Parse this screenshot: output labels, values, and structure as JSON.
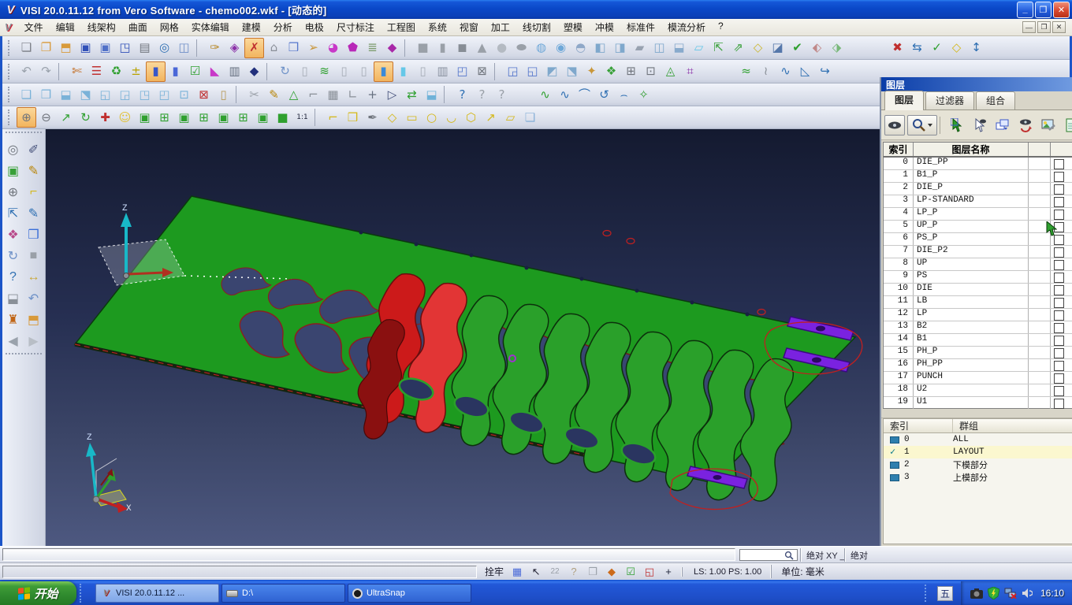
{
  "titlebar": {
    "title": "VISI 20.0.11.12 from Vero Software - chemo002.wkf - [动态的]",
    "app_mark": "V"
  },
  "menubar": {
    "items": [
      "文件",
      "编辑",
      "线架构",
      "曲面",
      "网格",
      "实体编辑",
      "建模",
      "分析",
      "电极",
      "尺寸标注",
      "工程图",
      "系统",
      "视窗",
      "加工",
      "线切割",
      "塑模",
      "冲模",
      "标准件",
      "模流分析",
      "?"
    ]
  },
  "toolbars": {
    "r1": [
      [
        "❏",
        "#7a7d85",
        "new-file"
      ],
      [
        "❐",
        "#d89a3a",
        "open-file"
      ],
      [
        "⬒",
        "#d89a3a",
        "folder-documents"
      ],
      [
        "▣",
        "#3050b8",
        "save"
      ],
      [
        "▣",
        "#5070c8",
        "save-as"
      ],
      [
        "◳",
        "#3050b8",
        "save-part"
      ],
      [
        "▤",
        "#70757d",
        "print"
      ],
      [
        "◎",
        "#2e6fb2",
        "print-preview"
      ],
      [
        "◫",
        "#7090c8",
        "split-window"
      ],
      "|",
      [
        "✑",
        "#b88a2a",
        "sketch-tool"
      ],
      [
        "◈",
        "#8a30a8",
        "point-tool"
      ],
      [
        "✗",
        "#c03030",
        "delete-sketch",
        "sel"
      ],
      [
        "⌂",
        "#8a8f98",
        "analysis-marker"
      ],
      [
        "❒",
        "#5577cc",
        "sheet-cube"
      ],
      [
        "➢",
        "#c9973a",
        "direction-arrow"
      ],
      [
        "◕",
        "#c838c8",
        "rainbow-surface"
      ],
      [
        "⬟",
        "#b828b8",
        "solid-magenta"
      ],
      [
        "≣",
        "#7a9a6a",
        "layer-stack"
      ],
      [
        "◆",
        "#a828a8",
        "magenta-box"
      ],
      "|",
      [
        "■",
        "#9aa0a8",
        "box-primitive"
      ],
      [
        "▮",
        "#9aa0a8",
        "cylinder-primitive"
      ],
      [
        "◼",
        "#878d95",
        "block-primitive"
      ],
      [
        "▲",
        "#9aa0a8",
        "cone-primitive"
      ],
      [
        "●",
        "#b4bac2",
        "sphere-primitive"
      ],
      [
        "⬬",
        "#9aa0a8",
        "torus-primitive"
      ],
      [
        "◍",
        "#6fa8d8",
        "extrude-tool"
      ],
      [
        "◉",
        "#6fa8d8",
        "revolve-tool"
      ],
      [
        "◓",
        "#8fa8c8",
        "half-sphere"
      ],
      [
        "◧",
        "#7fa8cc",
        "boolean-union"
      ],
      [
        "◨",
        "#7fa8cc",
        "boolean-subtract"
      ],
      [
        "▰",
        "#98a2b0",
        "boolean-intersect"
      ],
      [
        "◫",
        "#7fa8cc",
        "shell-tool"
      ],
      [
        "⬓",
        "#88aacc",
        "split-solid"
      ],
      [
        "▱",
        "#66c8e8",
        "plane-tool"
      ],
      [
        "⇱",
        "#38a038",
        "move-face"
      ],
      [
        "⇗",
        "#38a038",
        "pull-face"
      ],
      [
        "◇",
        "#ccb833",
        "feature-tool"
      ],
      [
        "◪",
        "#5577aa",
        "fillet-tool"
      ],
      [
        "✔",
        "#2fa02f",
        "validate-tool"
      ],
      [
        "⬖",
        "#c08888",
        "deform-tool"
      ],
      [
        "⬗",
        "#78b878",
        "blend-tool"
      ],
      "g52",
      [
        "✖",
        "#c03030",
        "right-tool-reset"
      ],
      [
        "⇆",
        "#2e6fb2",
        "right-tool-swap"
      ],
      [
        "✓",
        "#2fa02f",
        "right-tool-confirm"
      ],
      [
        "◇",
        "#d4b81a",
        "right-tool-frame"
      ],
      [
        "↕",
        "#2e6fb2",
        "right-tool-flip"
      ]
    ],
    "r2": [
      [
        "↶",
        "#9aa2ac",
        "undo"
      ],
      [
        "↷",
        "#9aa2ac",
        "redo"
      ],
      "|",
      [
        "✄",
        "#c06515",
        "trim-curves"
      ],
      [
        "☰",
        "#c03030",
        "attribute-filter"
      ],
      [
        "♻",
        "#2fa02f",
        "recycle-filter"
      ],
      [
        "±",
        "#b8a200",
        "plus-minus-tool"
      ],
      [
        "▮",
        "#3a57c8",
        "cylinder-select",
        "sel"
      ],
      [
        "▮",
        "#4a67d8",
        "cylinder-view"
      ],
      [
        "☑",
        "#2fa02f",
        "validate-solid"
      ],
      [
        "◣",
        "#c838c8",
        "wedge-tool"
      ],
      [
        "▥",
        "#667080",
        "ribbed-cylinder"
      ],
      [
        "◆",
        "#22307c",
        "shield-solid"
      ],
      "|",
      [
        "↻",
        "#6f92c8",
        "regen-tool"
      ],
      [
        "▯",
        "#a8aeb8",
        "cylinder-a"
      ],
      [
        "≋",
        "#2fa02f",
        "laminate-tool"
      ],
      [
        "▯",
        "#a8aeb8",
        "cylinder-b"
      ],
      [
        "▯",
        "#a8aeb8",
        "cylinder-c"
      ],
      [
        "▮",
        "#3a8ad8",
        "cylinder-active",
        "sel"
      ],
      [
        "▮",
        "#66c8e8",
        "cylinder-cyan"
      ],
      [
        "▯",
        "#a8aeb8",
        "cylinder-d"
      ],
      [
        "▥",
        "#8a92a0",
        "ribbed-b"
      ],
      [
        "◰",
        "#5577cc",
        "corner-box"
      ],
      [
        "⊠",
        "#70757d",
        "delete-box"
      ],
      "|",
      [
        "◲",
        "#5577cc",
        "swap-box"
      ],
      [
        "◱",
        "#5577cc",
        "box-lower"
      ],
      [
        "◩",
        "#7fa8cc",
        "half-box"
      ],
      [
        "⬔",
        "#7fa8cc",
        "quarter-box"
      ],
      [
        "✦",
        "#c9973a",
        "spark-tool"
      ],
      [
        "❖",
        "#38a038",
        "pattern-tool"
      ],
      [
        "⊞",
        "#70757d",
        "grid-box"
      ],
      [
        "⊡",
        "#70757d",
        "dot-box"
      ],
      [
        "◬",
        "#38a038",
        "tri-face"
      ],
      [
        "⌗",
        "#8a30a8",
        "hash-tool"
      ],
      "g46",
      [
        "≈",
        "#2fa02f",
        "tail-wave"
      ],
      [
        "≀",
        "#8a9098",
        "tail-wire"
      ],
      [
        "∿",
        "#2e6fb2",
        "tail-curve"
      ],
      [
        "◺",
        "#2e6fb2",
        "tail-corner"
      ],
      [
        "↪",
        "#2e6fb2",
        "tail-redirect"
      ]
    ],
    "r3": [
      [
        "❑",
        "#7ab2d8",
        "cube-edit-1"
      ],
      [
        "❒",
        "#7ab2d8",
        "cube-edit-2"
      ],
      [
        "⬓",
        "#7ab2d8",
        "cube-down-face"
      ],
      [
        "⬔",
        "#7ab2d8",
        "cube-corner"
      ],
      [
        "◱",
        "#7ab2d8",
        "cube-lower"
      ],
      [
        "◲",
        "#7ab2d8",
        "cube-right"
      ],
      [
        "◳",
        "#7ab2d8",
        "cube-upper"
      ],
      [
        "◰",
        "#7ab2d8",
        "cube-left"
      ],
      [
        "⊡",
        "#7ab2d8",
        "cube-center"
      ],
      [
        "⊠",
        "#c03030",
        "cube-delete"
      ],
      [
        "▯",
        "#b89a5a",
        "purge-bin"
      ],
      "|",
      [
        "✂",
        "#9aa0a8",
        "cut-sketch"
      ],
      [
        "✎",
        "#b8860b",
        "pencil-circle"
      ],
      [
        "△",
        "#2fa02f",
        "triangle-tool"
      ],
      [
        "⌐",
        "#8a9098",
        "corner-tool"
      ],
      [
        "▦",
        "#8a9098",
        "hatch-grid"
      ],
      [
        "∟",
        "#8a9098",
        "angle-tool"
      ],
      [
        "+",
        "#667080",
        "cross-marker"
      ],
      [
        "▷",
        "#44507a",
        "play-select"
      ],
      [
        "⇄",
        "#2fa02f",
        "swap-direction"
      ],
      [
        "⬓",
        "#6fb2d8",
        "bucket-tool"
      ],
      "|",
      [
        "?",
        "#2e6fb2",
        "help-context"
      ],
      [
        "?",
        "#9aa0a8",
        "help-point"
      ],
      [
        "?",
        "#9aa0a8",
        "help-entity"
      ],
      "g30",
      [
        "∿",
        "#2fa02f",
        "curve-green"
      ],
      [
        "∿",
        "#2e6fb2",
        "curve-blue"
      ],
      [
        "⌒",
        "#2e6fb2",
        "arc-blue"
      ],
      [
        "↺",
        "#2e6fb2",
        "rotate-curve"
      ],
      [
        "⌢",
        "#2e6fb2",
        "arc-down"
      ],
      [
        "✧",
        "#38a038",
        "star-curve"
      ]
    ],
    "r4": [
      [
        "⊕",
        "#70757d",
        "zoom-window",
        "sel"
      ],
      [
        "⊖",
        "#70757d",
        "zoom-dynamic"
      ],
      [
        "↗",
        "#2fa02f",
        "pan-view"
      ],
      [
        "↻",
        "#2fa02f",
        "rotate-view"
      ],
      [
        "✚",
        "#c03030",
        "axis-tool"
      ],
      [
        "☺",
        "#e0c030",
        "shading-mode"
      ],
      [
        "▣",
        "#2fa02f",
        "view-iso"
      ],
      [
        "⊞",
        "#2fa02f",
        "view-front"
      ],
      [
        "▣",
        "#2fa02f",
        "view-back"
      ],
      [
        "⊞",
        "#2fa02f",
        "view-left"
      ],
      [
        "▣",
        "#2fa02f",
        "view-right"
      ],
      [
        "⊞",
        "#2fa02f",
        "view-top"
      ],
      [
        "▣",
        "#2fa02f",
        "view-bottom"
      ],
      [
        "■",
        "#2fa02f",
        "view-shaded"
      ],
      [
        "1:1",
        "#20253a",
        "scale-one-to-one"
      ],
      "|",
      [
        "⌐",
        "#d4b81a",
        "profile-corner"
      ],
      [
        "❒",
        "#d4b81a",
        "profile-rect"
      ],
      [
        "✒",
        "#70757d",
        "pen-tool"
      ],
      [
        "◇",
        "#d4b81a",
        "profile-diamond"
      ],
      [
        "▭",
        "#d4b81a",
        "profile-slot"
      ],
      [
        "○",
        "#d4b81a",
        "profile-circle"
      ],
      [
        "◡",
        "#d4b81a",
        "profile-arc"
      ],
      [
        "⬡",
        "#d4b81a",
        "profile-polygon"
      ],
      [
        "↗",
        "#d4b81a",
        "profile-export"
      ],
      [
        "▱",
        "#d4b81a",
        "profile-skew"
      ],
      [
        "❏",
        "#8ab2d8",
        "profile-page"
      ]
    ]
  },
  "left_toolbar": {
    "icons": [
      [
        "◎",
        "#70757d",
        "zoom-select"
      ],
      [
        "✐",
        "#44507a",
        "pencil-delete"
      ],
      [
        "▣",
        "#38a038",
        "frame-select"
      ],
      [
        "✎",
        "#b8860b",
        "pencil-spline"
      ],
      [
        "⊕",
        "#70757d",
        "zoom-plus"
      ],
      [
        "⌐",
        "#d4b81a",
        "profile-yellow"
      ],
      [
        "⇱",
        "#2e6fb2",
        "measure-move"
      ],
      [
        "✎",
        "#2e6fb2",
        "pencil-curve"
      ],
      [
        "❖",
        "#b84a8a",
        "palette-tool"
      ],
      [
        "❒",
        "#3a6fd8",
        "tiles-blue"
      ],
      [
        "↻",
        "#6f92c8",
        "refresh-view"
      ],
      [
        "■",
        "#9aa0a8",
        "solid-gray"
      ],
      [
        "?",
        "#2e6fb2",
        "help-tool"
      ],
      [
        "↔",
        "#c9a83a",
        "measure-distance"
      ],
      [
        "⬓",
        "#8a9098",
        "trash-tool"
      ],
      [
        "↶",
        "#6f92c8",
        "undo-left"
      ],
      [
        "♜",
        "#c06515",
        "forklift-tool"
      ],
      [
        "⬒",
        "#d89a3a",
        "export-folder"
      ],
      [
        "◀",
        "#9aa2ac",
        "nav-back"
      ],
      [
        "▶",
        "#b8bec6",
        "nav-forward"
      ]
    ]
  },
  "viewport": {
    "axis_z": "Z",
    "axis_x": "X"
  },
  "layers_panel": {
    "title": "图层",
    "tabs": [
      {
        "label": "图层",
        "active": true
      },
      {
        "label": "过滤器",
        "active": false
      },
      {
        "label": "组合",
        "active": false
      }
    ],
    "table": {
      "col_index": "索引",
      "col_name": "图层名称",
      "rows": [
        [
          0,
          "DIE_PP"
        ],
        [
          1,
          "B1_P"
        ],
        [
          2,
          "DIE_P"
        ],
        [
          3,
          "LP-STANDARD"
        ],
        [
          4,
          "LP_P"
        ],
        [
          5,
          "UP_P"
        ],
        [
          6,
          "PS_P"
        ],
        [
          7,
          "DIE_P2"
        ],
        [
          8,
          "UP"
        ],
        [
          9,
          "PS"
        ],
        [
          10,
          "DIE"
        ],
        [
          11,
          "LB"
        ],
        [
          12,
          "LP"
        ],
        [
          13,
          "B2"
        ],
        [
          14,
          "B1"
        ],
        [
          15,
          "PH_P"
        ],
        [
          16,
          "PH_PP"
        ],
        [
          17,
          "PUNCH"
        ],
        [
          18,
          "U2"
        ],
        [
          19,
          "U1"
        ]
      ]
    }
  },
  "groups_panel": {
    "col_index": "索引",
    "col_name": "群组",
    "rows": [
      {
        "index": 0,
        "name": "ALL",
        "checked": false
      },
      {
        "index": 1,
        "name": "LAYOUT",
        "checked": true
      },
      {
        "index": 2,
        "name": "下模部分",
        "checked": false
      },
      {
        "index": 3,
        "name": "上模部分",
        "checked": false
      }
    ]
  },
  "command_bar": {
    "abs_xy": "绝对 XY _",
    "abs": "绝对"
  },
  "status_bar": {
    "snap": "拴牢",
    "icons": [
      {
        "g": "▦",
        "c": "#4a6ad8",
        "n": "grid-toggle"
      },
      {
        "g": "↖",
        "c": "#223",
        "n": "cursor-mode"
      },
      {
        "g": "22",
        "c": "#9aa0a8",
        "n": "badge-22"
      },
      {
        "g": "?",
        "c": "#b0a080",
        "n": "help-disabled"
      },
      {
        "g": "❒",
        "c": "#9aa0a8",
        "n": "doc-disabled"
      },
      {
        "g": "◆",
        "c": "#cc6a1a",
        "n": "solid-mode"
      },
      {
        "g": "☑",
        "c": "#2fa02f",
        "n": "check-mode"
      },
      {
        "g": "◱",
        "c": "#c03030",
        "n": "screen-capture"
      },
      {
        "g": "+",
        "c": "#20253a",
        "n": "plus-tool"
      }
    ],
    "ls_ps": "LS: 1.00 PS: 1.00",
    "units": "单位: 毫米"
  },
  "taskbar": {
    "start": "开始",
    "tasks": [
      {
        "label": "VISI 20.0.11.12 ...",
        "icon": "visi",
        "glyph": "V",
        "active": true
      },
      {
        "label": "D:\\",
        "icon": "drive",
        "glyph": "",
        "active": false
      },
      {
        "label": "UltraSnap",
        "icon": "cam",
        "glyph": "",
        "active": false
      }
    ],
    "ime": "五",
    "clock": "16:10"
  }
}
